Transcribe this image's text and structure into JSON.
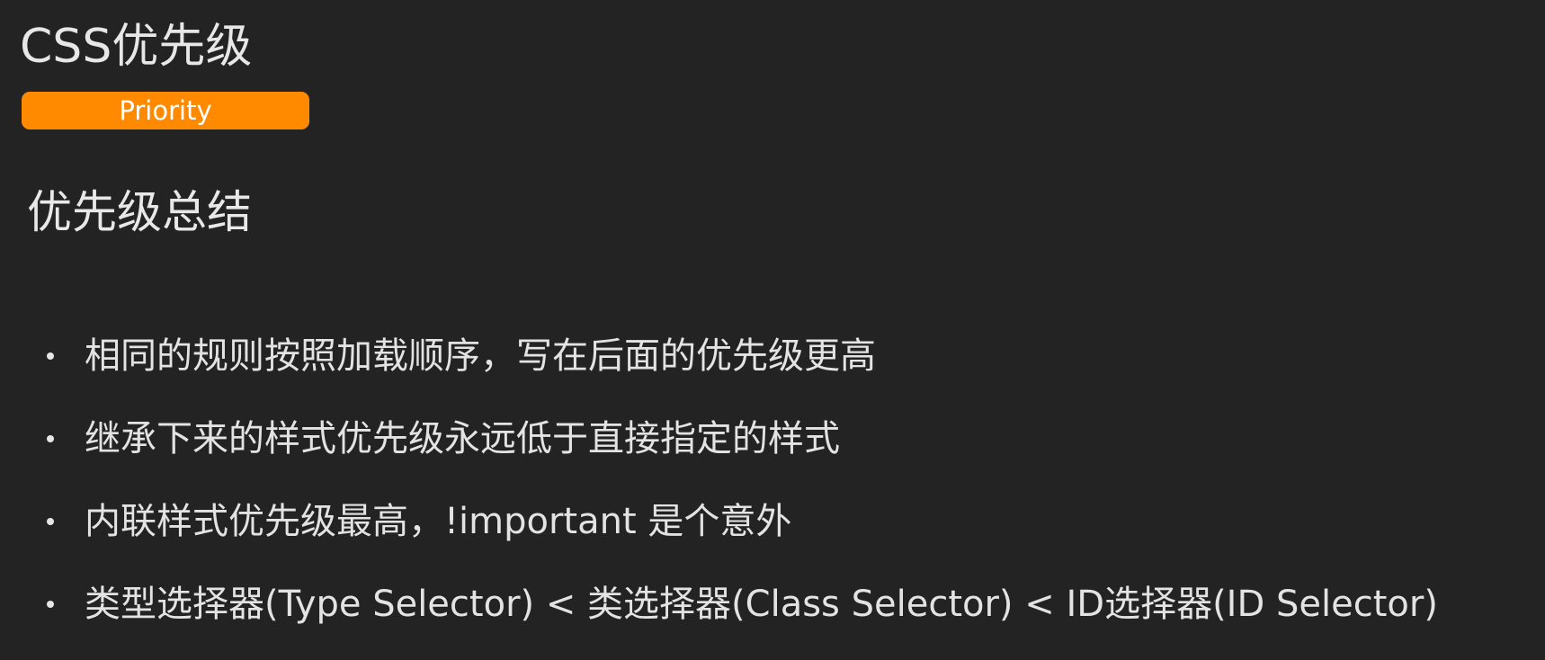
{
  "slide": {
    "title": "CSS优先级",
    "badge": "Priority",
    "section_title": "优先级总结",
    "bullets": [
      "相同的规则按照加载顺序，写在后面的优先级更高",
      "继承下来的样式优先级永远低于直接指定的样式",
      "内联样式优先级最高，!important 是个意外",
      "类型选择器(Type Selector) < 类选择器(Class Selector) < ID选择器(ID Selector)"
    ]
  },
  "colors": {
    "background": "#232323",
    "text": "#e6e6e6",
    "accent": "#ff8a00",
    "badge_text": "#ffffff"
  }
}
